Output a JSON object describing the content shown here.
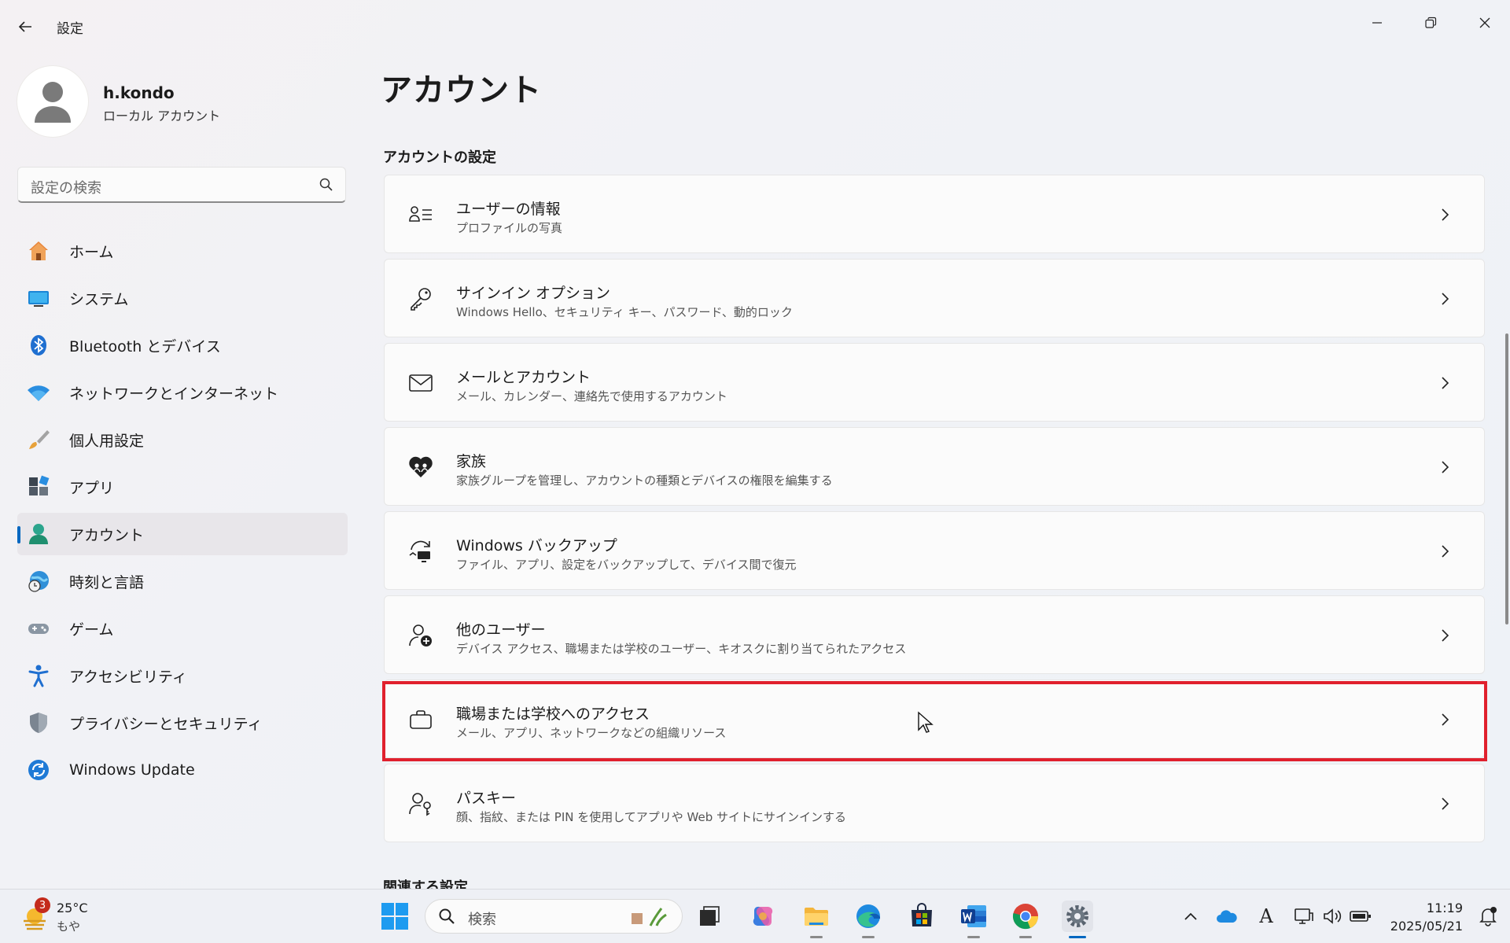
{
  "titlebar": {
    "title": "設定"
  },
  "profile": {
    "name": "h.kondo",
    "type": "ローカル アカウント"
  },
  "search": {
    "placeholder": "設定の検索"
  },
  "nav": {
    "items": [
      {
        "label": "ホーム",
        "icon": "home-icon"
      },
      {
        "label": "システム",
        "icon": "system-icon"
      },
      {
        "label": "Bluetooth とデバイス",
        "icon": "bluetooth-icon"
      },
      {
        "label": "ネットワークとインターネット",
        "icon": "wifi-icon"
      },
      {
        "label": "個人用設定",
        "icon": "brush-icon"
      },
      {
        "label": "アプリ",
        "icon": "apps-icon"
      },
      {
        "label": "アカウント",
        "icon": "account-icon",
        "active": true
      },
      {
        "label": "時刻と言語",
        "icon": "globe-clock-icon"
      },
      {
        "label": "ゲーム",
        "icon": "gamepad-icon"
      },
      {
        "label": "アクセシビリティ",
        "icon": "accessibility-icon"
      },
      {
        "label": "プライバシーとセキュリティ",
        "icon": "shield-icon"
      },
      {
        "label": "Windows Update",
        "icon": "update-icon"
      }
    ]
  },
  "main": {
    "title": "アカウント",
    "section": "アカウントの設定",
    "cards": [
      {
        "title": "ユーザーの情報",
        "subtitle": "プロファイルの写真",
        "icon": "user-info-icon"
      },
      {
        "title": "サインイン オプション",
        "subtitle": "Windows Hello、セキュリティ キー、パスワード、動的ロック",
        "icon": "key-icon"
      },
      {
        "title": "メールとアカウント",
        "subtitle": "メール、カレンダー、連絡先で使用するアカウント",
        "icon": "mail-icon"
      },
      {
        "title": "家族",
        "subtitle": "家族グループを管理し、アカウントの種類とデバイスの権限を編集する",
        "icon": "family-heart-icon"
      },
      {
        "title": "Windows バックアップ",
        "subtitle": "ファイル、アプリ、設定をバックアップして、デバイス間で復元",
        "icon": "backup-icon"
      },
      {
        "title": "他のユーザー",
        "subtitle": "デバイス アクセス、職場または学校のユーザー、キオスクに割り当てられたアクセス",
        "icon": "add-user-icon"
      },
      {
        "title": "職場または学校へのアクセス",
        "subtitle": "メール、アプリ、ネットワークなどの組織リソース",
        "icon": "briefcase-icon",
        "highlighted": true
      },
      {
        "title": "パスキー",
        "subtitle": "顔、指紋、または PIN を使用してアプリや Web サイトにサインインする",
        "icon": "passkey-icon"
      }
    ],
    "related": "関連する設定"
  },
  "taskbar": {
    "weather_temp": "25°C",
    "weather_cond": "もや",
    "weather_badge": "3",
    "search_placeholder": "検索",
    "time": "11:19",
    "date": "2025/05/21",
    "ime": "A"
  },
  "colors": {
    "accent": "#0067c0",
    "highlight": "#e0202d"
  }
}
